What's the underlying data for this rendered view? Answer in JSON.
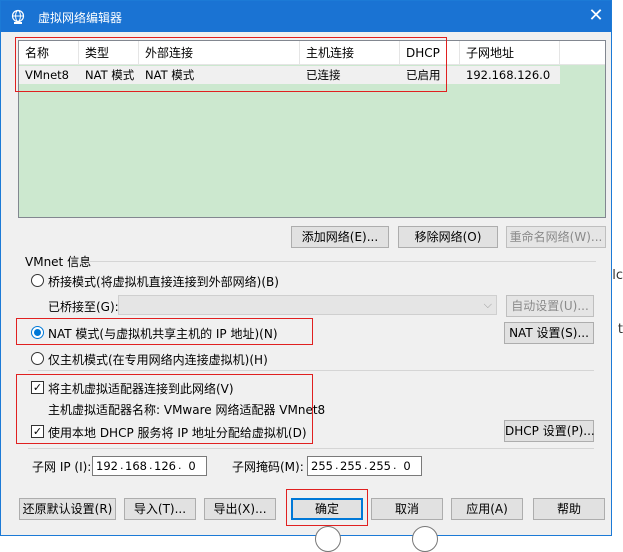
{
  "window": {
    "title": "虚拟网络编辑器",
    "close_glyph": "✕"
  },
  "list": {
    "columns": [
      "名称",
      "类型",
      "外部连接",
      "主机连接",
      "DHCP",
      "子网地址"
    ],
    "rows": [
      {
        "name": "VMnet8",
        "type": "NAT 模式",
        "external": "NAT 模式",
        "host": "已连接",
        "dhcp": "已启用",
        "subnet": "192.168.126.0"
      }
    ]
  },
  "list_buttons": {
    "add": "添加网络(E)...",
    "remove": "移除网络(O)",
    "rename": "重命名网络(W)..."
  },
  "vmnet_info": {
    "group_label": "VMnet 信息",
    "bridge_label": "桥接模式(将虚拟机直接连接到外部网络)(B)",
    "bridged_to_label": "已桥接至(G):",
    "auto_settings": "自动设置(U)...",
    "nat_label": "NAT 模式(与虚拟机共享主机的 IP 地址)(N)",
    "nat_settings": "NAT 设置(S)...",
    "hostonly_label": "仅主机模式(在专用网络内连接虚拟机)(H)",
    "connect_adapter_label": "将主机虚拟适配器连接到此网络(V)",
    "adapter_name_label": "主机虚拟适配器名称: VMware 网络适配器 VMnet8",
    "use_dhcp_label": "使用本地 DHCP 服务将 IP 地址分配给虚拟机(D)",
    "dhcp_settings": "DHCP 设置(P)...",
    "subnet_ip_label": "子网 IP (I):",
    "subnet_ip": [
      "192",
      "168",
      "126",
      "0"
    ],
    "subnet_mask_label": "子网掩码(M):",
    "subnet_mask": [
      "255",
      "255",
      "255",
      "0"
    ],
    "selected_mode": "nat",
    "connect_adapter_checked": true,
    "use_dhcp_checked": true
  },
  "footer_buttons": {
    "restore": "还原默认设置(R)",
    "import": "导入(T)...",
    "export": "导出(X)...",
    "ok": "确定",
    "cancel": "取消",
    "apply": "应用(A)",
    "help": "帮助"
  },
  "background_text": {
    "side_1": "lc",
    "side_2": "t"
  },
  "colors": {
    "titlebar": "#1a73d3",
    "list_background": "#cce8cf",
    "highlight_box": "#e02020"
  }
}
